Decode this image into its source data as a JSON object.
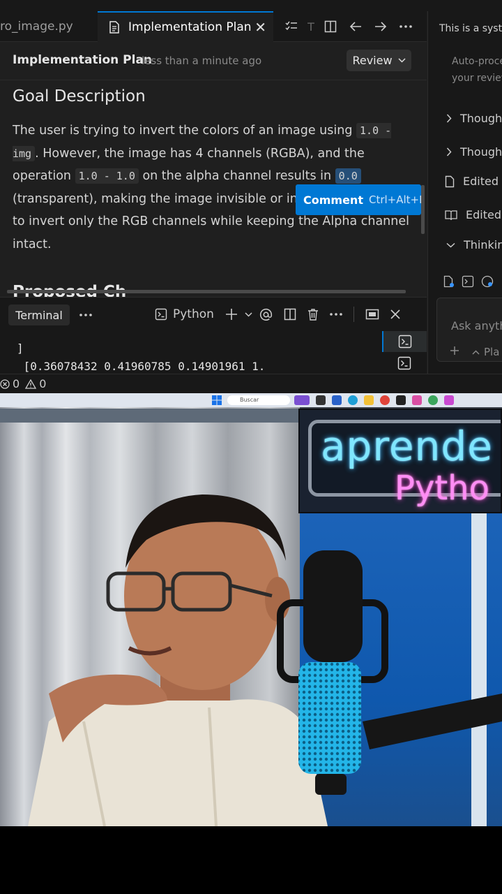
{
  "editor": {
    "tabs": [
      {
        "label": "ro_image.py",
        "active": false
      },
      {
        "label": "Implementation Plan",
        "active": true
      }
    ],
    "close_glyph": "✕",
    "tab_overflow_label": "T"
  },
  "document": {
    "title": "Implementation Plan",
    "timestamp": "less than a minute ago",
    "review_label": "Review",
    "heading": "Goal Description",
    "para_parts": [
      "The user is trying to invert the colors of an image using ",
      "1.0 - img",
      ". However, the image has 4 channels (RGBA), and the operation ",
      "1.0 - 1.0",
      " on the alpha channel results in ",
      "0.0",
      " (transparent), making the image invisible or inc",
      " to invert only the RGB channels while keeping the Alpha channel intact."
    ],
    "next_heading": "Proposed Ch"
  },
  "comment_popup": {
    "label": "Comment",
    "shortcut": "Ctrl+Alt+M"
  },
  "terminal": {
    "tab_label": "Terminal",
    "profile_label": "Python",
    "output_lines": [
      "]",
      " [0.36078432 0.41960785 0.14901961 1."
    ]
  },
  "statusbar": {
    "errors": "0",
    "warnings": "0"
  },
  "right_panel": {
    "system_text": "This is a syste",
    "auto_text_1": "Auto-proce",
    "auto_text_2": "your review",
    "items": [
      {
        "label": "Though",
        "icon": "chevron-right"
      },
      {
        "label": "Though",
        "icon": "chevron-right"
      },
      {
        "label": "Edited",
        "icon": "file"
      },
      {
        "label": "Edited",
        "icon": "book"
      },
      {
        "label": "Thinkir",
        "icon": "chevron-down"
      }
    ],
    "ask_placeholder": "Ask anythi",
    "plan_label": "Pla"
  },
  "webcam": {
    "taskbar_search": "Buscar",
    "banner_line1": "aprende",
    "banner_line2": "Pytho"
  },
  "colors": {
    "accent": "#0078d4",
    "editor_bg": "#1f1f1f",
    "panel_bg": "#181818"
  }
}
